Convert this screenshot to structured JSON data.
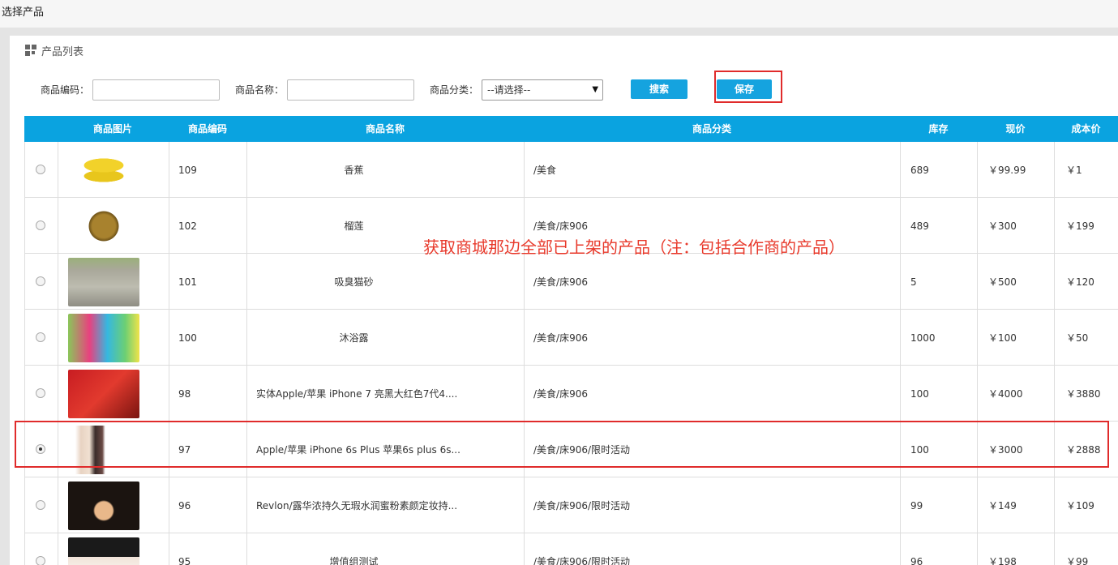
{
  "window": {
    "title": "选择产品"
  },
  "panel": {
    "title": "产品列表",
    "icon": "grid-icon"
  },
  "filters": {
    "code_label": "商品编码：",
    "code_value": "",
    "name_label": "商品名称：",
    "name_value": "",
    "category_label": "商品分类：",
    "category_selected": "--请选择--"
  },
  "buttons": {
    "search": "搜索",
    "save": "保存"
  },
  "columns": [
    "商品图片",
    "商品编码",
    "商品名称",
    "商品分类",
    "库存",
    "现价",
    "成本价"
  ],
  "rows": [
    {
      "code": "109",
      "name": "香蕉",
      "category": "/美食",
      "stock": "689",
      "price": "￥99.99",
      "cost": "￥1",
      "selected": false,
      "image": "banana"
    },
    {
      "code": "102",
      "name": "榴莲",
      "category": "/美食/床906",
      "stock": "489",
      "price": "￥300",
      "cost": "￥199",
      "selected": false,
      "image": "durian"
    },
    {
      "code": "101",
      "name": "吸臭猫砂",
      "category": "/美食/床906",
      "stock": "5",
      "price": "￥500",
      "cost": "￥120",
      "selected": false,
      "image": "cat-litter"
    },
    {
      "code": "100",
      "name": "沐浴露",
      "category": "/美食/床906",
      "stock": "1000",
      "price": "￥100",
      "cost": "￥50",
      "selected": false,
      "image": "shower-gel"
    },
    {
      "code": "98",
      "name": "实体Apple/苹果 iPhone 7 亮黑大红色7代4....",
      "category": "/美食/床906",
      "stock": "100",
      "price": "￥4000",
      "cost": "￥3880",
      "selected": false,
      "image": "iphone-red"
    },
    {
      "code": "97",
      "name": "Apple/苹果 iPhone 6s Plus 苹果6s plus 6s...",
      "category": "/美食/床906/限时活动",
      "stock": "100",
      "price": "￥3000",
      "cost": "￥2888",
      "selected": true,
      "image": "iphone-6s"
    },
    {
      "code": "96",
      "name": "Revlon/露华浓持久无瑕水润蜜粉素颜定妆持...",
      "category": "/美食/床906/限时活动",
      "stock": "99",
      "price": "￥149",
      "cost": "￥109",
      "selected": false,
      "image": "powder-compact"
    },
    {
      "code": "95",
      "name": "增值组测试",
      "category": "/美食/床906/限时活动",
      "stock": "96",
      "price": "￥198",
      "cost": "￥99",
      "selected": false,
      "image": "product-box"
    }
  ],
  "annotation": "获取商城那边全部已上架的产品（注：包括合作商的产品）",
  "colors": {
    "header": "#0aa3e0",
    "button": "#15a3df",
    "highlight": "#e02b2b"
  }
}
